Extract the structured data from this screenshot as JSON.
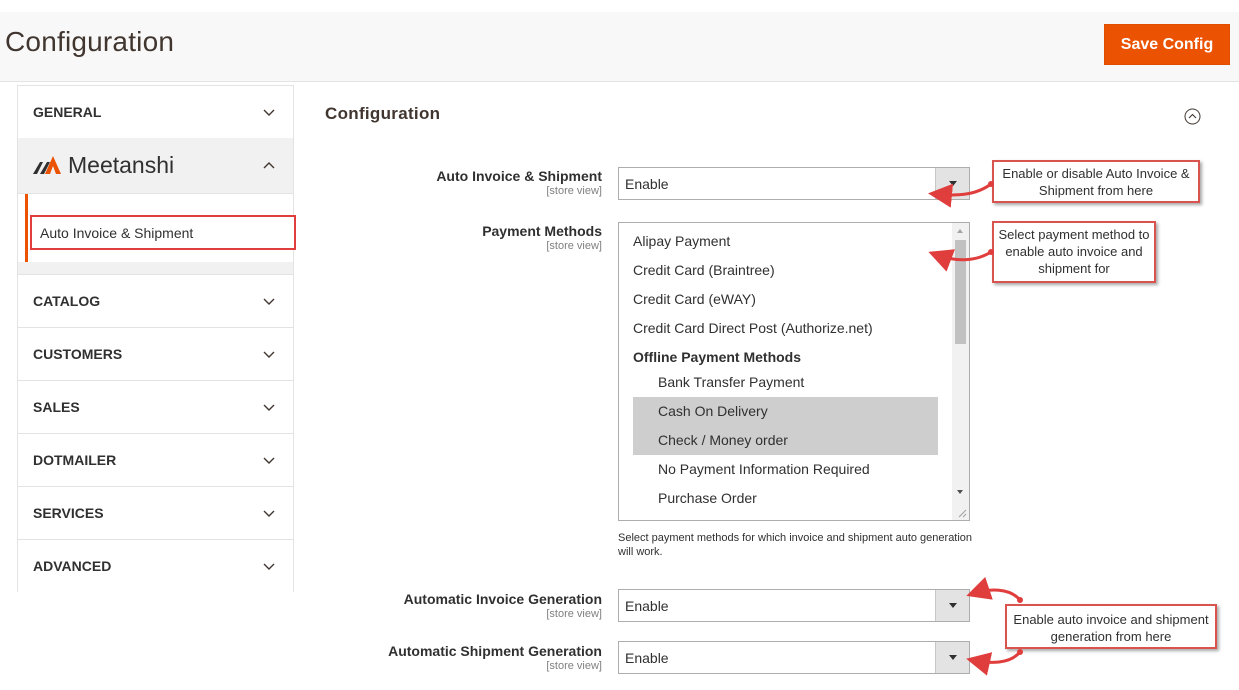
{
  "header": {
    "title": "Configuration",
    "save_label": "Save Config",
    "accent_color": "#eb5202"
  },
  "sidebar": {
    "general": "GENERAL",
    "brand": "Meetanshi",
    "brand_item": "Auto Invoice & Shipment",
    "sections": [
      "CATALOG",
      "CUSTOMERS",
      "SALES",
      "DOTMAILER",
      "SERVICES",
      "ADVANCED"
    ]
  },
  "main": {
    "section_title": "Configuration",
    "scope_label": "[store view]",
    "fields": {
      "auto_invoice_shipment": {
        "label": "Auto Invoice & Shipment",
        "value": "Enable"
      },
      "payment_methods": {
        "label": "Payment Methods",
        "options": [
          {
            "text": "Alipay Payment",
            "type": "option",
            "selected": false
          },
          {
            "text": "Credit Card (Braintree)",
            "type": "option",
            "selected": false
          },
          {
            "text": "Credit Card (eWAY)",
            "type": "option",
            "selected": false
          },
          {
            "text": "Credit Card Direct Post (Authorize.net)",
            "type": "option",
            "selected": false
          },
          {
            "text": "Offline Payment Methods",
            "type": "group",
            "selected": false
          },
          {
            "text": "Bank Transfer Payment",
            "type": "child",
            "selected": false
          },
          {
            "text": "Cash On Delivery",
            "type": "child",
            "selected": true
          },
          {
            "text": "Check / Money order",
            "type": "child",
            "selected": true
          },
          {
            "text": "No Payment Information Required",
            "type": "child",
            "selected": false
          },
          {
            "text": "Purchase Order",
            "type": "child",
            "selected": false
          }
        ],
        "note": "Select payment methods for which invoice and shipment auto generation will work."
      },
      "automatic_invoice_generation": {
        "label": "Automatic Invoice Generation",
        "value": "Enable"
      },
      "automatic_shipment_generation": {
        "label": "Automatic Shipment Generation",
        "value": "Enable"
      }
    }
  },
  "callouts": {
    "enable_disable": "Enable or disable Auto Invoice & Shipment from here",
    "select_payment": "Select payment method to enable auto invoice and shipment for",
    "enable_auto": "Enable auto invoice and shipment generation from here",
    "border_color": "#d9534f"
  }
}
